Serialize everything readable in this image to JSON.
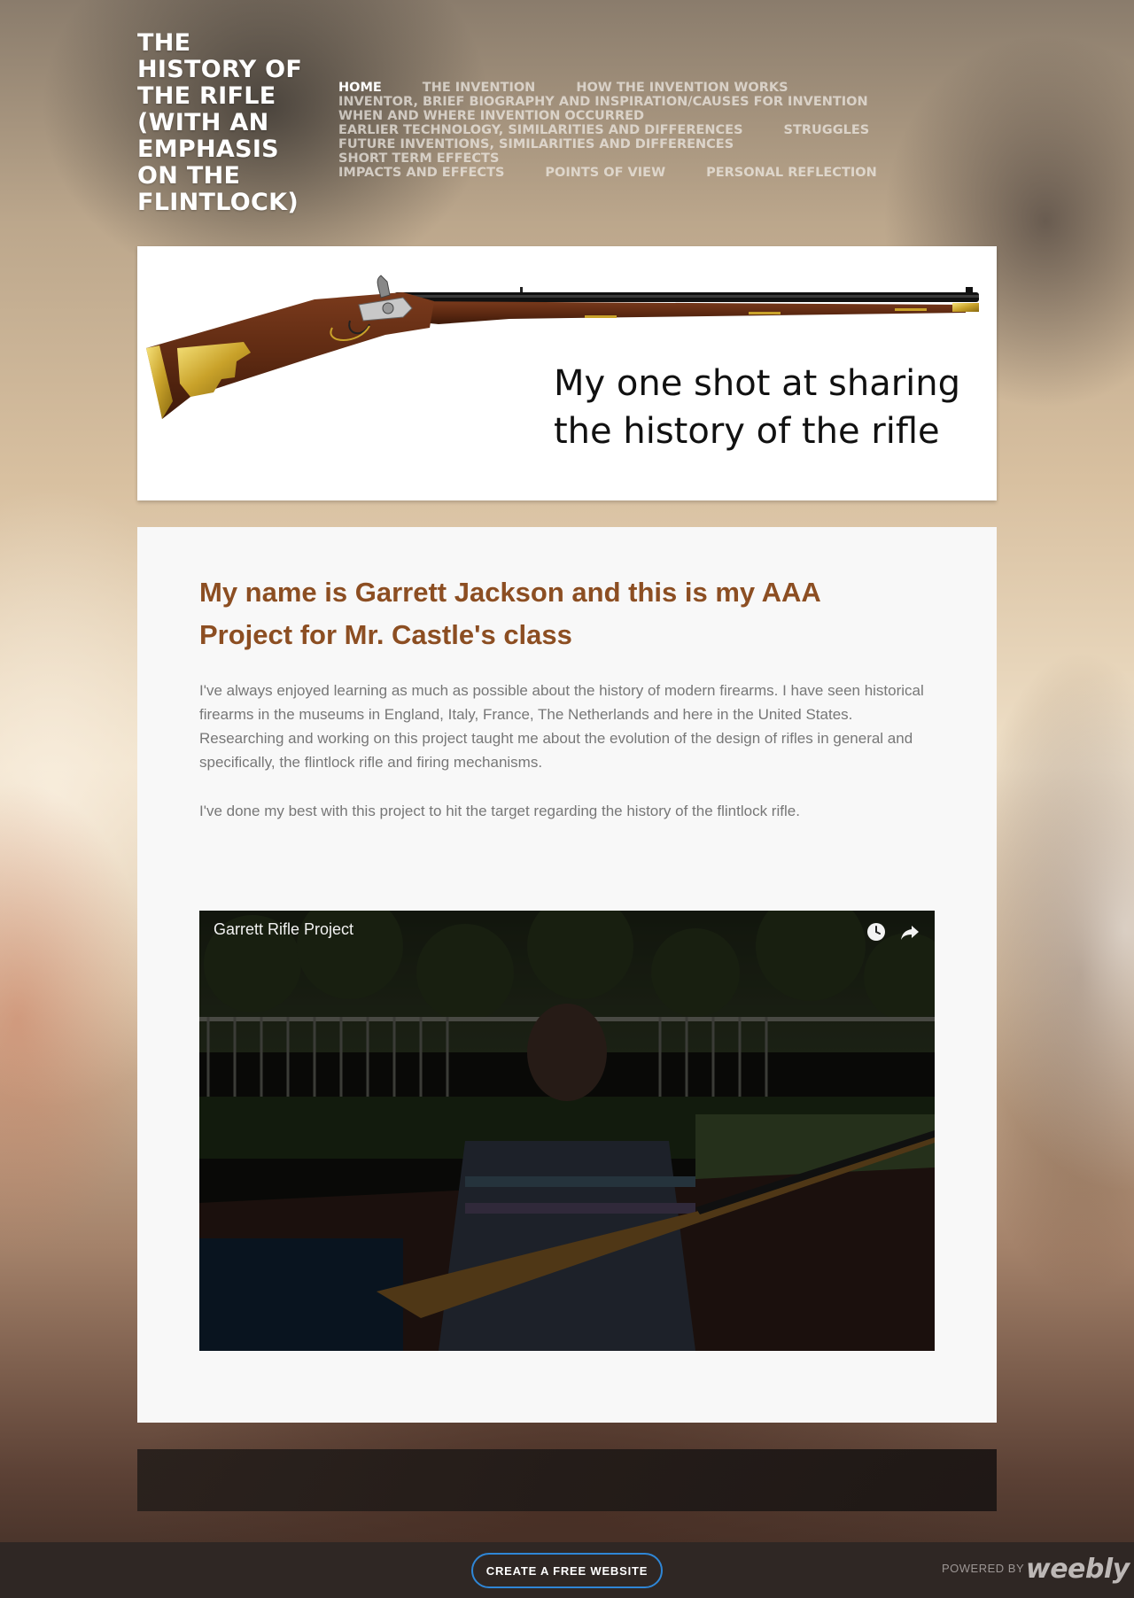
{
  "site": {
    "title": "THE HISTORY OF THE RIFLE (WITH AN EMPHASIS ON THE FLINTLOCK)"
  },
  "nav": {
    "items": [
      {
        "label": "HOME",
        "active": true
      },
      {
        "label": "THE INVENTION"
      },
      {
        "label": "HOW THE INVENTION WORKS"
      },
      {
        "label": "INVENTOR, BRIEF BIOGRAPHY AND INSPIRATION/CAUSES FOR INVENTION"
      },
      {
        "label": "WHEN AND WHERE INVENTION OCCURRED"
      },
      {
        "label": "EARLIER TECHNOLOGY, SIMILARITIES AND DIFFERENCES"
      },
      {
        "label": "STRUGGLES"
      },
      {
        "label": "FUTURE INVENTIONS, SIMILARITIES AND DIFFERENCES"
      },
      {
        "label": "SHORT TERM EFFECTS"
      },
      {
        "label": "IMPACTS AND EFFECTS"
      },
      {
        "label": "POINTS OF VIEW"
      },
      {
        "label": "PERSONAL REFLECTION"
      }
    ]
  },
  "banner": {
    "tagline_line1": "My one shot at sharing",
    "tagline_line2": "the history of the rifle"
  },
  "content": {
    "heading": "My name is Garrett Jackson and this is my AAA Project for Mr. Castle's class",
    "paragraph1": "I've always enjoyed learning as much as possible about the history of modern firearms. I have seen historical firearms in the museums in England, Italy, France, The Netherlands and here in the United States. Researching and working on this project taught me about the evolution of the design of rifles in general and specifically, the flintlock rifle and firing mechanisms.",
    "paragraph2": "I've done my best with this project to hit the target regarding the history of the flintlock rifle."
  },
  "video": {
    "title": "Garrett Rifle Project",
    "icons": [
      "watch-later-icon",
      "share-icon"
    ]
  },
  "footer": {
    "cta_label": "CREATE A FREE WEBSITE",
    "powered_by": "POWERED BY",
    "brand": "weebly",
    "cta_color": "#2f86d6"
  }
}
